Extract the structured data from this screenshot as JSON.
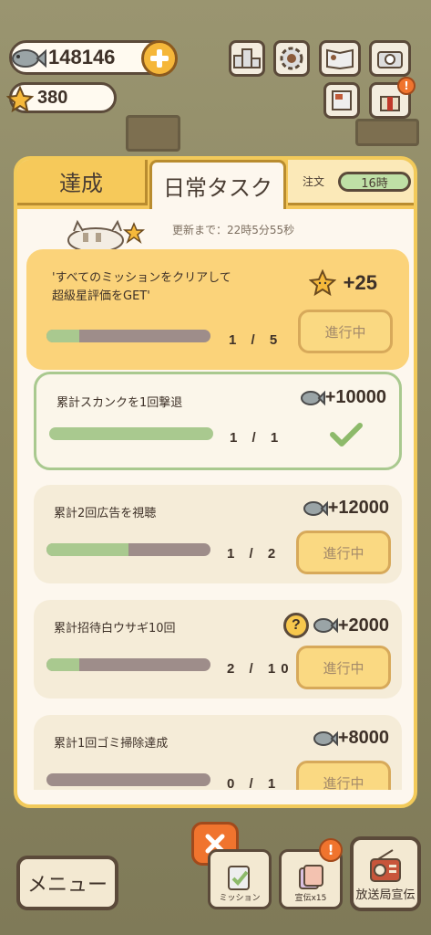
{
  "currency": {
    "fish": "148146",
    "stars": "380"
  },
  "tabs": {
    "achievements": "達成",
    "daily": "日常タスク"
  },
  "order": {
    "label": "注文",
    "time": "16時"
  },
  "update_text": "更新まで：22時5分55秒",
  "tasks": [
    {
      "title_line1": "'すべてのミッションをクリアして",
      "title_line2": "超級星評価をGET'",
      "reward": "+25",
      "current": "1",
      "total": "5",
      "progress": 0.2,
      "button": "進行中"
    },
    {
      "title_line1": "累計スカンクを1回撃退",
      "reward": "+10000",
      "current": "1",
      "total": "1",
      "progress": 1.0,
      "status": "complete"
    },
    {
      "title_line1": "累計2回広告を視聴",
      "reward": "+12000",
      "current": "1",
      "total": "2",
      "progress": 0.5,
      "button": "進行中"
    },
    {
      "title_line1": "累計招待白ウサギ10回",
      "reward": "+2000",
      "current": "2",
      "total": "10",
      "progress": 0.2,
      "button": "進行中"
    },
    {
      "title_line1": "累計1回ゴミ掃除達成",
      "reward": "+8000",
      "current": "0",
      "total": "1",
      "progress": 0.0,
      "button": "進行中"
    }
  ],
  "bottom": {
    "menu": "メニュー",
    "mission": "ミッション",
    "ad": "宣伝x15",
    "broadcast": "放送局宣伝"
  },
  "colors": {
    "panel_border": "#f2ca5a",
    "progress_fill": "#a9c98f",
    "close": "#f0742e"
  }
}
